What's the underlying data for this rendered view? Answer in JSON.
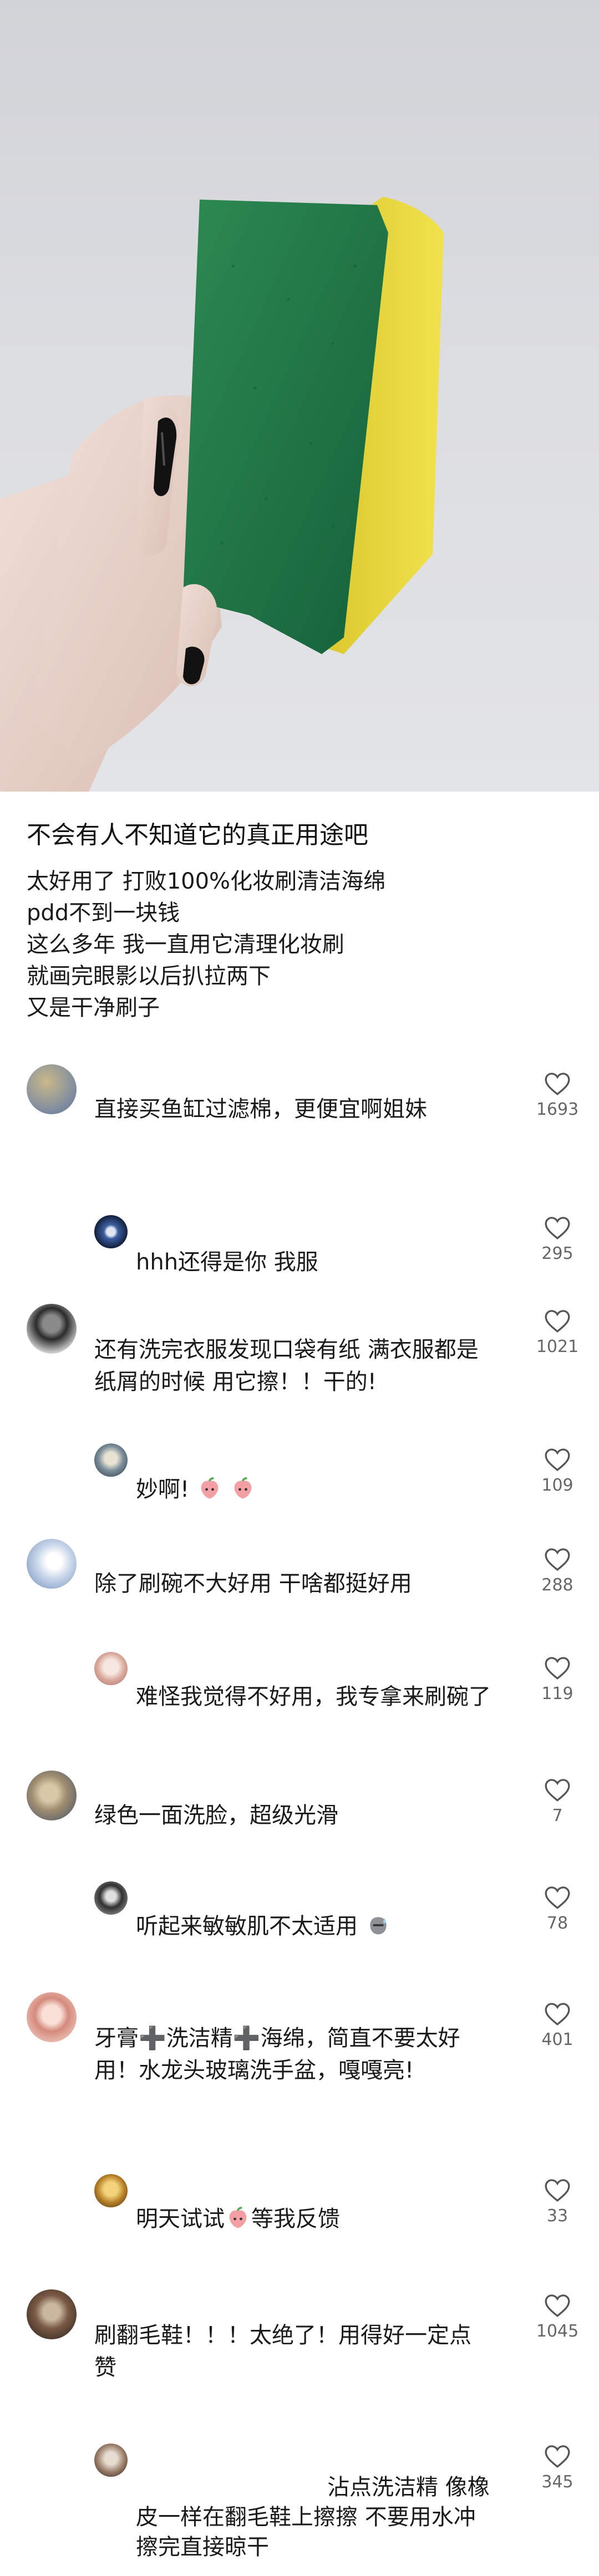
{
  "post": {
    "title": "不会有人不知道它的真正用途吧",
    "body": [
      "太好用了 打败100%化妆刷清洁海绵",
      "pdd不到一块钱",
      "这么多年 我一直用它清理化妆刷",
      "就画完眼影以后扒拉两下",
      "又是干净刷子"
    ]
  },
  "comments": [
    {
      "text": [
        "直接买鱼缸过滤棉，更便宜啊姐妹"
      ],
      "likes": "1693"
    },
    {
      "text": [
        "hhh还得是你 我服"
      ],
      "likes": "295"
    },
    {
      "text": [
        "还有洗完衣服发现口袋有纸 满衣服都是",
        "纸屑的时候 用它擦！！干的!"
      ],
      "likes": "1021"
    },
    {
      "text": [
        "妙啊!"
      ],
      "likes": "109"
    },
    {
      "text": [
        "除了刷碗不大好用 干啥都挺好用"
      ],
      "likes": "288"
    },
    {
      "text": [
        "难怪我觉得不好用，我专拿来刷碗了"
      ],
      "likes": "119"
    },
    {
      "text": [
        "绿色一面洗脸，超级光滑"
      ],
      "likes": "7"
    },
    {
      "text": [
        "听起来敏敏肌不太适用"
      ],
      "likes": "78"
    },
    {
      "text": [
        "牙膏➕洗洁精➕海绵，简直不要太好",
        "用！水龙头玻璃洗手盆，嘎嘎亮!"
      ],
      "likes": "401"
    },
    {
      "text_a": "明天试试",
      "text_b": "等我反馈",
      "likes": "33"
    },
    {
      "text": [
        "刷翻毛鞋！！！太绝了！用得好一定点",
        "赞"
      ],
      "likes": "1045"
    },
    {
      "text": [
        "沾点洗洁精 像橡",
        "皮一样在翻毛鞋上擦擦 不要用水冲",
        "擦完直接晾干"
      ],
      "likes": "345"
    }
  ],
  "icons": {
    "like": "heart-outline-icon",
    "emoji_peach": "peach-emoji-icon",
    "emoji_sweat": "sweat-emoji-icon"
  },
  "colors": {
    "sponge_green": "#1f7a46",
    "sponge_yellow": "#e8d63a",
    "like_icon": "#555555"
  }
}
